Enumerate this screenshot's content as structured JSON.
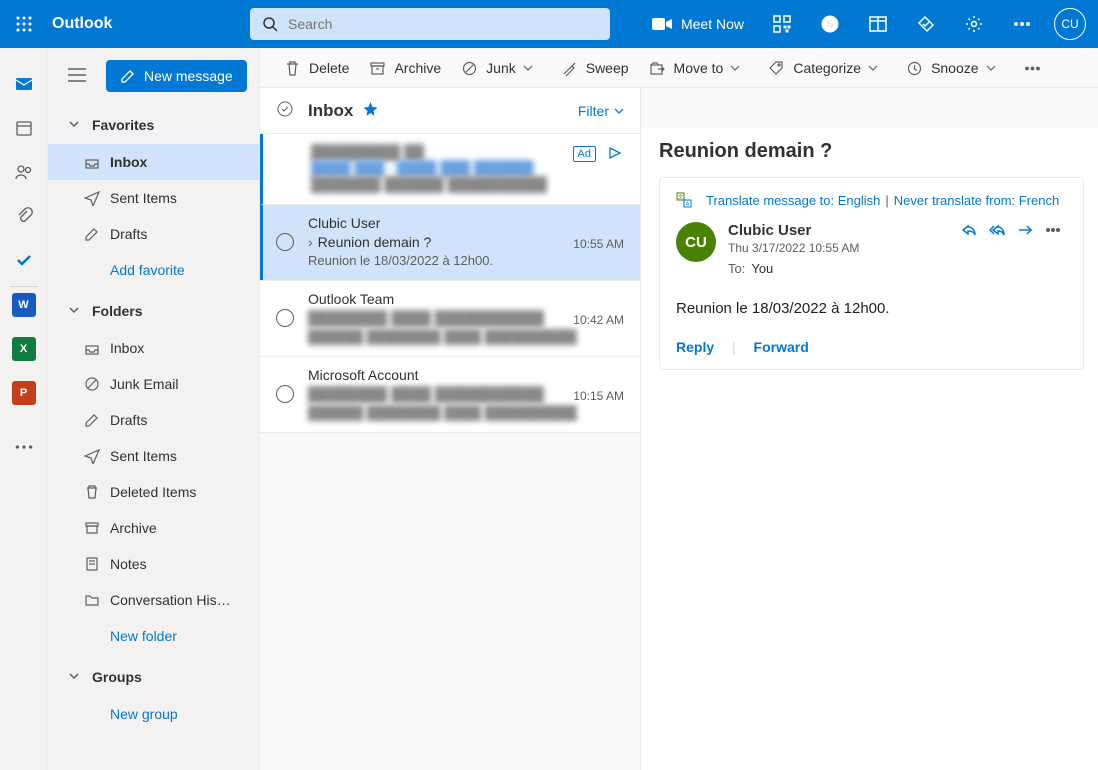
{
  "header": {
    "brand": "Outlook",
    "search_placeholder": "Search",
    "meet_now": "Meet Now",
    "avatar_initials": "CU"
  },
  "command_bar": {
    "new_message": "New message",
    "delete": "Delete",
    "archive": "Archive",
    "junk": "Junk",
    "sweep": "Sweep",
    "move_to": "Move to",
    "categorize": "Categorize",
    "snooze": "Snooze"
  },
  "nav": {
    "favorites_label": "Favorites",
    "folders_label": "Folders",
    "groups_label": "Groups",
    "add_favorite": "Add favorite",
    "new_folder": "New folder",
    "new_group": "New group",
    "favorites": [
      {
        "label": "Inbox",
        "icon": "inbox",
        "selected": true
      },
      {
        "label": "Sent Items",
        "icon": "sent"
      },
      {
        "label": "Drafts",
        "icon": "drafts"
      }
    ],
    "folders": [
      {
        "label": "Inbox",
        "icon": "inbox"
      },
      {
        "label": "Junk Email",
        "icon": "junk"
      },
      {
        "label": "Drafts",
        "icon": "drafts"
      },
      {
        "label": "Sent Items",
        "icon": "sent"
      },
      {
        "label": "Deleted Items",
        "icon": "trash"
      },
      {
        "label": "Archive",
        "icon": "archive"
      },
      {
        "label": "Notes",
        "icon": "notes"
      },
      {
        "label": "Conversation His…",
        "icon": "folder"
      }
    ]
  },
  "left_rail_apps": [
    {
      "letter": "W",
      "color": "#185abd",
      "name": "word"
    },
    {
      "letter": "X",
      "color": "#107c41",
      "name": "excel"
    },
    {
      "letter": "P",
      "color": "#c43e1c",
      "name": "powerpoint"
    }
  ],
  "list": {
    "title": "Inbox",
    "filter_label": "Filter",
    "ad_label": "Ad",
    "messages": [
      {
        "sender": "Clubic User",
        "subject": "Reunion demain ?",
        "preview": "Reunion le 18/03/2022 à 12h00.",
        "time": "10:55 AM",
        "selected": true,
        "has_chevron": true
      },
      {
        "sender": "Outlook Team",
        "subject": "",
        "preview": "",
        "time": "10:42 AM"
      },
      {
        "sender": "Microsoft Account",
        "subject": "",
        "preview": "",
        "time": "10:15 AM"
      }
    ]
  },
  "reading": {
    "subject": "Reunion demain ?",
    "translate_prefix": "Translate message to: ",
    "translate_lang": "English",
    "never_prefix": "Never translate from: ",
    "never_lang": "French",
    "from_name": "Clubic User",
    "from_initials": "CU",
    "date": "Thu 3/17/2022 10:55 AM",
    "to_label": "To:",
    "to_value": "You",
    "body": "Reunion le 18/03/2022 à 12h00.",
    "reply_label": "Reply",
    "forward_label": "Forward"
  }
}
